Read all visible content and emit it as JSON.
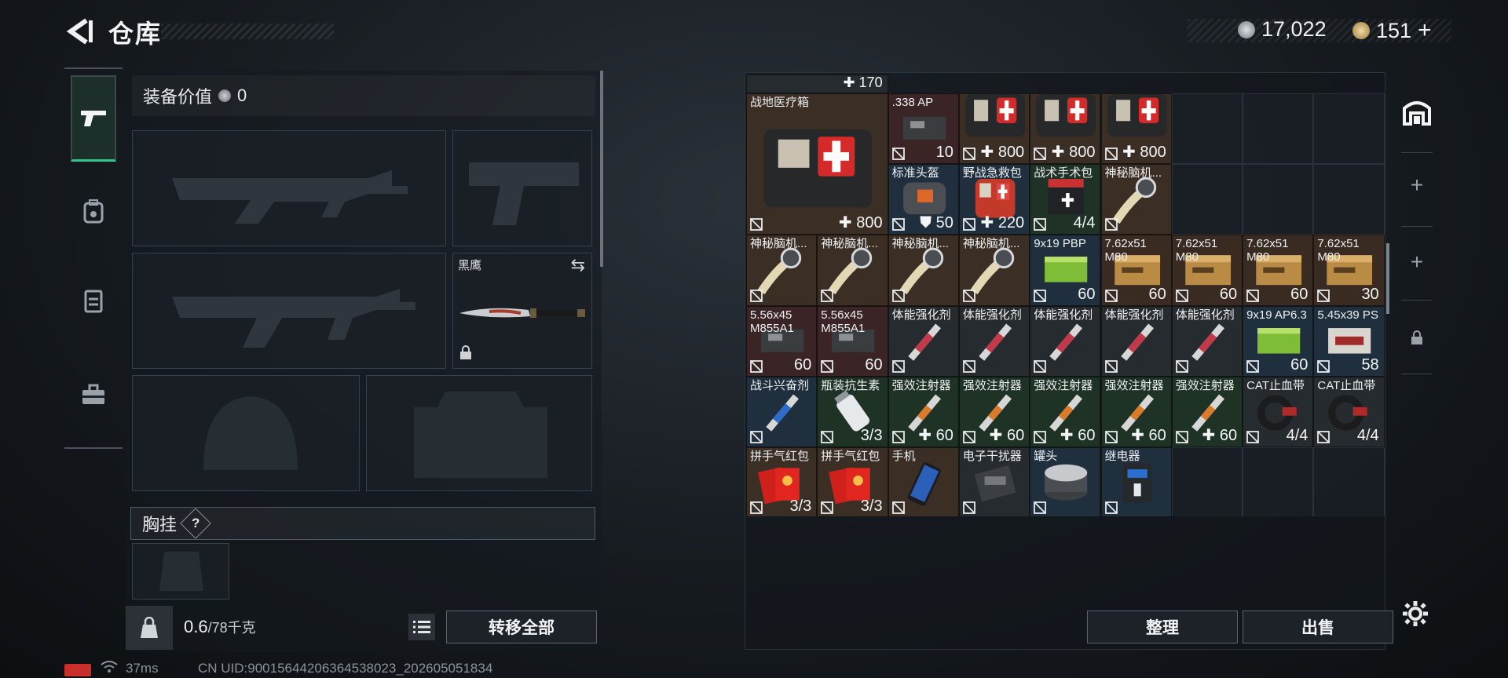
{
  "header": {
    "title": "仓库",
    "currency_silver": "17,022",
    "currency_gold": "151",
    "add_label": "+"
  },
  "equipment": {
    "value_label": "装备价值",
    "value": "0",
    "secondary_weapon_label": "黑鹰",
    "chest_rig_label": "胸挂",
    "help_label": "?"
  },
  "capacity": {
    "current": "0.6",
    "max": "/78千克"
  },
  "buttons": {
    "transfer_all": "转移全部",
    "sort": "整理",
    "sell": "出售"
  },
  "status": {
    "ping": "37ms",
    "uid": "CN UID:900156442063645380​23_202605051834"
  },
  "storage": {
    "top_row_value": "170",
    "items": [
      {
        "name": "战地医疗箱",
        "qty": "800",
        "kind": "medbox"
      },
      {
        "name": ".338 AP",
        "qty": "10",
        "kind": "ammo_red"
      },
      {
        "name": "",
        "qty": "800",
        "kind": "medbox_small"
      },
      {
        "name": "",
        "qty": "800",
        "kind": "medbox_small"
      },
      {
        "name": "",
        "qty": "800",
        "kind": "medbox_small"
      },
      {
        "name": "标准头盔",
        "qty": "50",
        "kind": "bag"
      },
      {
        "name": "野战急救包",
        "qty": "220",
        "kind": "firstaid"
      },
      {
        "name": "战术手术包",
        "qty": "4/4",
        "kind": "surgical"
      },
      {
        "name": "神秘脑机...",
        "qty": "",
        "kind": "brain"
      },
      {
        "name": "神秘脑机...",
        "qty": "",
        "kind": "brain"
      },
      {
        "name": "神秘脑机...",
        "qty": "",
        "kind": "brain"
      },
      {
        "name": "神秘脑机...",
        "qty": "",
        "kind": "brain"
      },
      {
        "name": "神秘脑机...",
        "qty": "",
        "kind": "brain"
      },
      {
        "name": "9x19 PBP",
        "qty": "60",
        "kind": "ammo_green"
      },
      {
        "name": "7.62x51 M80",
        "qty": "60",
        "kind": "ammo_box"
      },
      {
        "name": "7.62x51 M80",
        "qty": "60",
        "kind": "ammo_box"
      },
      {
        "name": "7.62x51 M80",
        "qty": "60",
        "kind": "ammo_box"
      },
      {
        "name": "7.62x51 M80",
        "qty": "30",
        "kind": "ammo_box"
      },
      {
        "name": "5.56x45 M855A1",
        "qty": "60",
        "kind": "ammo_red"
      },
      {
        "name": "5.56x45 M855A1",
        "qty": "60",
        "kind": "ammo_red"
      },
      {
        "name": "体能强化剂",
        "qty": "",
        "kind": "syringe_red"
      },
      {
        "name": "体能强化剂",
        "qty": "",
        "kind": "syringe_red"
      },
      {
        "name": "体能强化剂",
        "qty": "",
        "kind": "syringe_red"
      },
      {
        "name": "体能强化剂",
        "qty": "",
        "kind": "syringe_red"
      },
      {
        "name": "体能强化剂",
        "qty": "",
        "kind": "syringe_red"
      },
      {
        "name": "9x19 AP6.3",
        "qty": "60",
        "kind": "ammo_green"
      },
      {
        "name": "5.45x39 PS",
        "qty": "58",
        "kind": "ammo_white"
      },
      {
        "name": "战斗兴奋剂",
        "qty": "",
        "kind": "syringe_blue"
      },
      {
        "name": "瓶装抗生素",
        "qty": "3/3",
        "kind": "bottle"
      },
      {
        "name": "强效注射器",
        "qty": "60",
        "kind": "syringe_gray"
      },
      {
        "name": "强效注射器",
        "qty": "60",
        "kind": "syringe_gray"
      },
      {
        "name": "强效注射器",
        "qty": "60",
        "kind": "syringe_gray"
      },
      {
        "name": "强效注射器",
        "qty": "60",
        "kind": "syringe_gray"
      },
      {
        "name": "强效注射器",
        "qty": "60",
        "kind": "syringe_gray"
      },
      {
        "name": "CAT止血带",
        "qty": "4/4",
        "kind": "tourniquet"
      },
      {
        "name": "CAT止血带",
        "qty": "4/4",
        "kind": "tourniquet"
      },
      {
        "name": "拼手气红包",
        "qty": "3/3",
        "kind": "redpacket"
      },
      {
        "name": "拼手气红包",
        "qty": "3/3",
        "kind": "redpacket"
      },
      {
        "name": "手机",
        "qty": "",
        "kind": "phone"
      },
      {
        "name": "电子干扰器",
        "qty": "",
        "kind": "jammer"
      },
      {
        "name": "罐头",
        "qty": "",
        "kind": "can"
      },
      {
        "name": "继电器",
        "qty": "",
        "kind": "relay"
      }
    ]
  },
  "colors": {
    "accent": "#36c48a",
    "cell_medical": "#3a2e25",
    "cell_ammo": "#3a2b22",
    "cell_blue": "#1f2f3d",
    "cell_green": "#1f3226",
    "cell_dark": "#262b30"
  }
}
